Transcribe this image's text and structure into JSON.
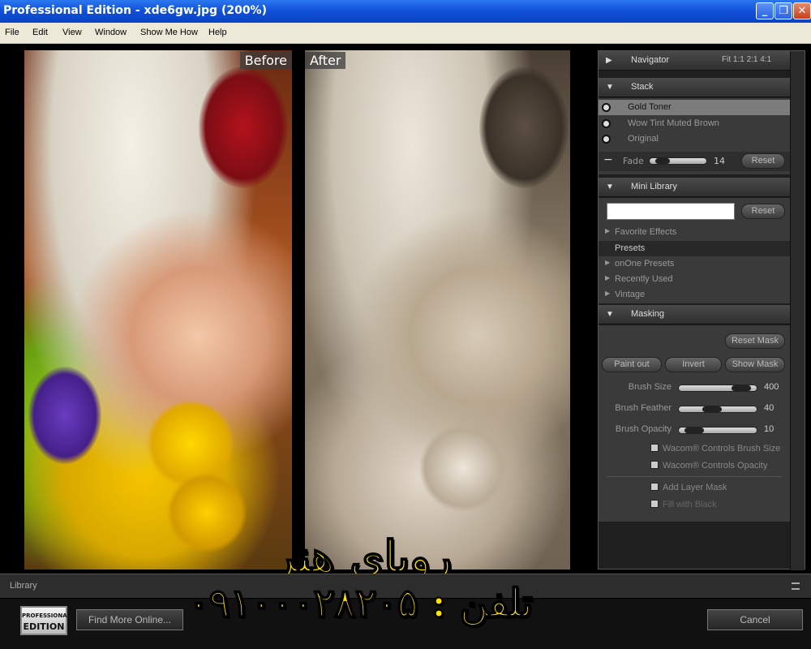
{
  "window": {
    "title": "Professional Edition - xde6gw.jpg (200%)",
    "minimize_glyph": "_",
    "maximize_glyph": "❐",
    "close_glyph": "✕"
  },
  "menu": [
    "File",
    "Edit",
    "View",
    "Window",
    "Show Me How",
    "Help"
  ],
  "canvas": {
    "before_label": "Before",
    "after_label": "After"
  },
  "panel": {
    "navigator": {
      "label": "Navigator",
      "zoom_options": "Fit  1:1  2:1  4:1"
    },
    "stack": {
      "label": "Stack",
      "items": [
        "Gold Toner",
        "Wow Tint Muted Brown",
        "Original"
      ],
      "selected_index": 0,
      "fade_label": "Fade",
      "fade_value": "14",
      "fade_level_percent": 14,
      "reset_label": "Reset"
    },
    "mini_library": {
      "label": "Mini Library",
      "search_value": "",
      "reset_label": "Reset",
      "items": [
        "Favorite Effects",
        "Presets",
        "onOne Presets",
        "Recently Used",
        "Vintage"
      ],
      "selected_index": 1
    },
    "masking": {
      "label": "Masking",
      "reset_mask_label": "Reset Mask",
      "paint_out_label": "Paint out",
      "invert_label": "Invert",
      "show_mask_label": "Show Mask",
      "brush_size_label": "Brush Size",
      "brush_size_value": "400",
      "brush_size_level_percent": 90,
      "brush_feather_label": "Brush Feather",
      "brush_feather_value": "40",
      "brush_feather_level_percent": 40,
      "brush_opacity_label": "Brush Opacity",
      "brush_opacity_value": "10",
      "brush_opacity_level_percent": 10,
      "wacom_size_label": "Wacom® Controls Brush Size",
      "wacom_opacity_label": "Wacom® Controls Opacity",
      "add_layer_mask_label": "Add Layer Mask",
      "fill_black_label": "Fill with Black"
    }
  },
  "library_bar": {
    "label": "Library"
  },
  "bottom": {
    "logo_small": "PROFESSIONAL",
    "logo_text": "EDITION",
    "find_more_label": "Find More Online...",
    "cancel_label": "Cancel"
  },
  "watermark": {
    "title": "رویای هنر",
    "phone": "تلفن : ۰۹۱۰۰۰۲۸۲۰۵"
  },
  "colors": {
    "title_bar": "#0f4fd8",
    "watermark": "#ffe100"
  }
}
